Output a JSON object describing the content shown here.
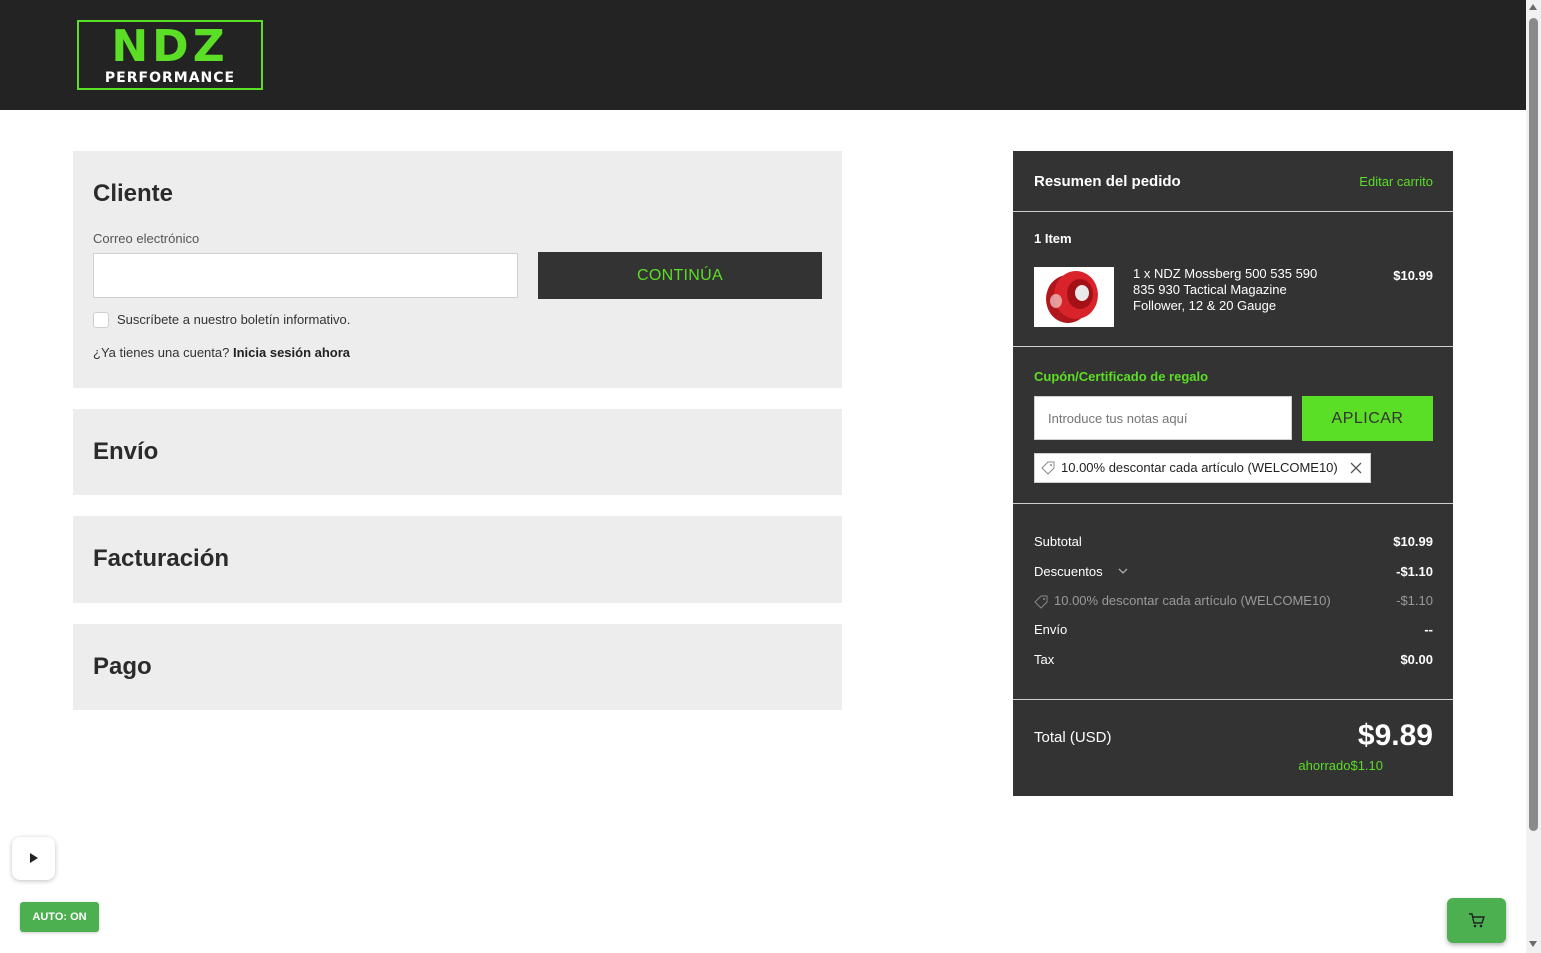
{
  "brand": {
    "logo_line1": "NDZ",
    "logo_line2": "PERFORMANCE",
    "accent_color": "#5bde26",
    "header_color": "#232323"
  },
  "steps": {
    "cliente": {
      "title": "Cliente",
      "email_label": "Correo electrónico",
      "email_value": "",
      "continue_label": "CONTINÚA",
      "subscribe_label": "Suscríbete a nuestro boletín informativo.",
      "subscribe_checked": false,
      "account_prompt": "¿Ya tienes una cuenta?",
      "signin_link": "Inicia sesión ahora"
    },
    "envio": {
      "title": "Envío"
    },
    "facturacion": {
      "title": "Facturación"
    },
    "pago": {
      "title": "Pago"
    }
  },
  "summary": {
    "title": "Resumen del pedido",
    "edit_cart": "Editar carrito",
    "item_count": "1 Item",
    "items": [
      {
        "name": "1 x NDZ Mossberg 500 535 590 835 930 Tactical Magazine Follower, 12 & 20 Gauge",
        "price": "$10.99",
        "image_icon": "red-magazine-follower-image"
      }
    ],
    "coupon": {
      "title": "Cupón/Certificado de regalo",
      "placeholder": "Introduce tus notas aquí",
      "apply_label": "APLICAR",
      "applied_tag": "10.00% descontar cada artículo (WELCOME10)"
    },
    "totals": {
      "subtotal_label": "Subtotal",
      "subtotal_value": "$10.99",
      "discounts_label": "Descuentos",
      "discounts_value": "-$1.10",
      "discount_detail_label": "10.00% descontar cada artículo (WELCOME10)",
      "discount_detail_value": "-$1.10",
      "shipping_label": "Envío",
      "shipping_value": "--",
      "tax_label": "Tax",
      "tax_value": "$0.00",
      "total_label": "Total (USD)",
      "total_value": "$9.89",
      "saved_text": "ahorrado$1.10"
    }
  },
  "widgets": {
    "auto_badge": "AUTO: ON",
    "play_icon": "play-icon",
    "cart_icon": "shopping-cart-icon"
  }
}
